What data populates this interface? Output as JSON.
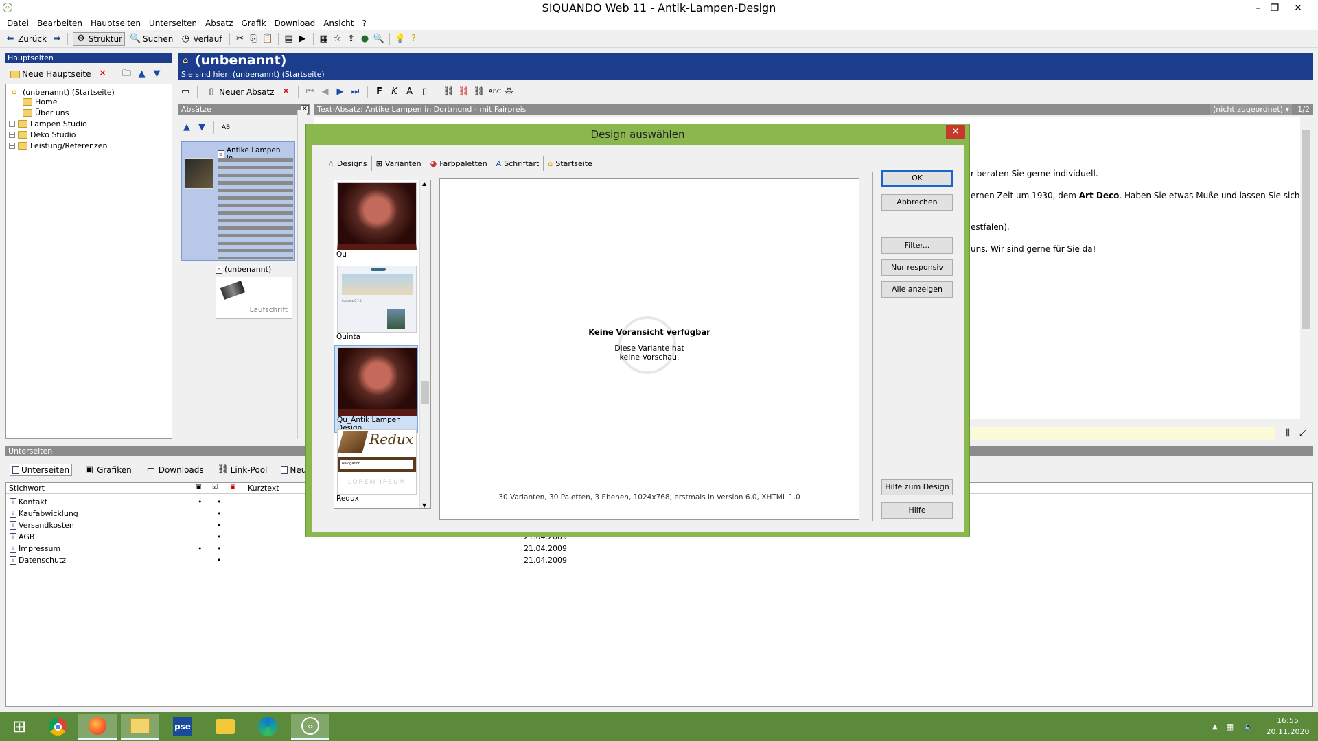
{
  "window": {
    "title": "SIQUANDO Web 11 - Antik-Lampen-Design"
  },
  "menu": [
    "Datei",
    "Bearbeiten",
    "Hauptseiten",
    "Unterseiten",
    "Absatz",
    "Grafik",
    "Download",
    "Ansicht",
    "?"
  ],
  "toolbar": {
    "back": "Zurück",
    "structure": "Struktur",
    "search": "Suchen",
    "history": "Verlauf"
  },
  "left_panel": {
    "header": "Hauptseiten",
    "new_page": "Neue Hauptseite",
    "tree": [
      {
        "label": "(unbenannt) (Startseite)"
      },
      {
        "label": "Home"
      },
      {
        "label": "Über uns"
      },
      {
        "label": "Lampen Studio"
      },
      {
        "label": "Deko Studio"
      },
      {
        "label": "Leistung/Referenzen"
      }
    ]
  },
  "page_header": {
    "title": "(unbenannt)",
    "breadcrumb": "Sie sind hier: (unbenannt) (Startseite)"
  },
  "editor_toolbar": {
    "new_paragraph": "Neuer Absatz"
  },
  "paragraphs": {
    "header": "Absätze",
    "item1_title": "Antike Lampen in...",
    "item2_title": "(unbenannt)",
    "item2_caption": "Laufschrift"
  },
  "text_paragraph": {
    "header": "Text-Absatz: Antike Lampen in Dortmund - mit Fairpreis",
    "assignment": "(nicht zugeordnet)",
    "page_count": "1/2",
    "lines": [
      "r beraten Sie gerne individuell.",
      "ernen Zeit um 1930, dem ",
      "Art Deco",
      ". Haben Sie etwas Muße und lassen Sie sich",
      "estfalen).",
      "uns. Wir sind gerne für Sie da!"
    ]
  },
  "subpages": {
    "header": "Unterseiten",
    "tabs": [
      "Unterseiten",
      "Grafiken",
      "Downloads",
      "Link-Pool",
      "Neue Ur"
    ],
    "columns": [
      "Stichwort",
      "Kurztext"
    ],
    "rows": [
      {
        "name": "Kontakt",
        "date": ""
      },
      {
        "name": "Kaufabwicklung",
        "date": ""
      },
      {
        "name": "Versandkosten",
        "date": ""
      },
      {
        "name": "AGB",
        "date": "21.04.2009"
      },
      {
        "name": "Impressum",
        "date": "21.04.2009"
      },
      {
        "name": "Datenschutz",
        "date": "21.04.2009"
      }
    ]
  },
  "dialog": {
    "title": "Design auswählen",
    "tabs": [
      "Designs",
      "Varianten",
      "Farbpaletten",
      "Schriftart",
      "Startseite"
    ],
    "designs": [
      "Qu",
      "Quinta",
      "Qu_Antik Lampen Design",
      "Redux"
    ],
    "redux_nav": "Navigation",
    "redux_lorem": "LOREM IPSUM",
    "quinta_caption": "Sumatra 9.7.0",
    "preview_title": "Keine Voransicht verfügbar",
    "preview_text_1": "Diese Variante hat",
    "preview_text_2": "keine Vorschau.",
    "info": "30 Varianten, 30 Paletten, 3 Ebenen, 1024x768, erstmals in Version 6.0, XHTML 1.0",
    "buttons": {
      "ok": "OK",
      "cancel": "Abbrechen",
      "filter": "Filter...",
      "responsive": "Nur responsiv",
      "show_all": "Alle anzeigen",
      "design_help": "Hilfe zum Design",
      "help": "Hilfe"
    }
  },
  "taskbar": {
    "pse_label": "pse",
    "time": "16:55",
    "date": "20.11.2020"
  },
  "colors": {
    "accent_blue": "#1c3c8c",
    "dialog_frame": "#8ab84e",
    "taskbar": "#5a8a3a",
    "close_red": "#c8372d"
  }
}
